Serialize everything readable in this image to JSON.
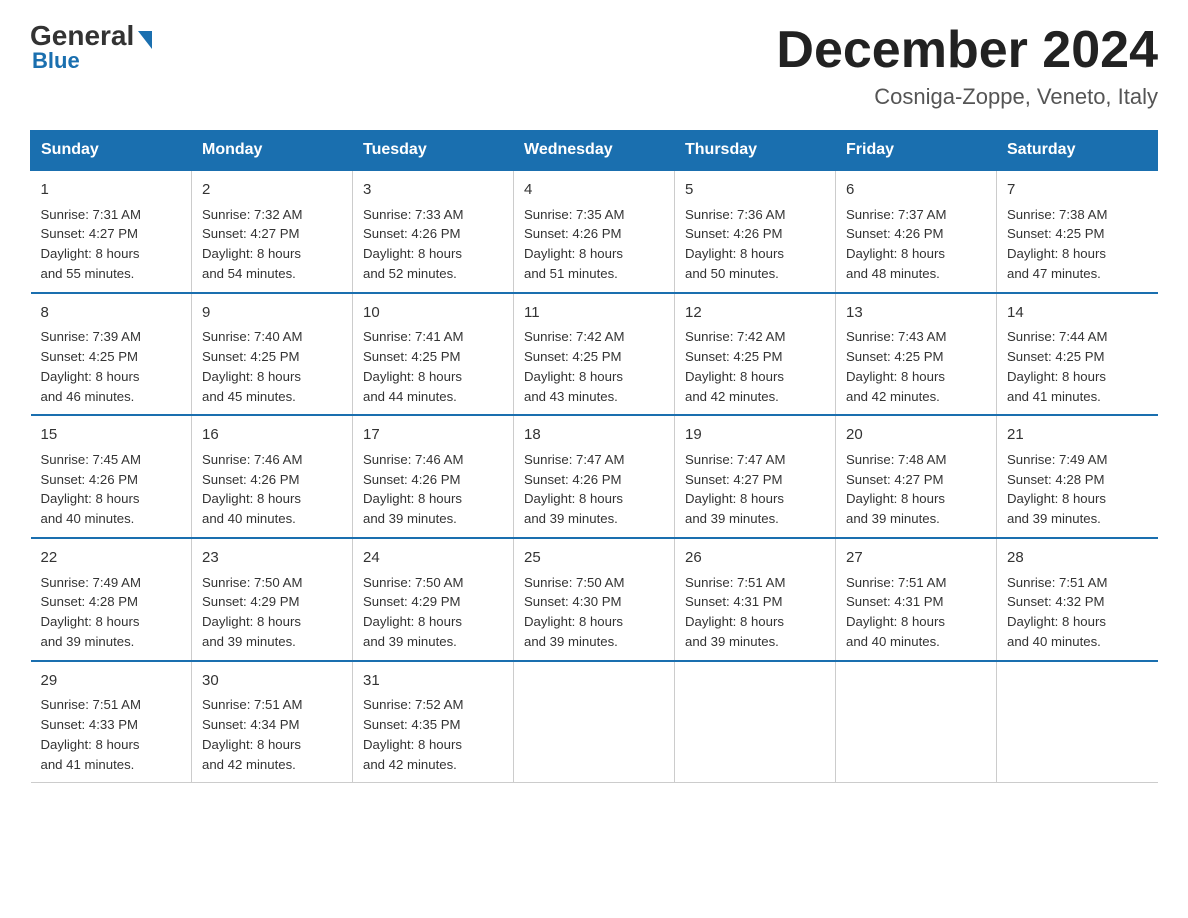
{
  "header": {
    "logo_general": "General",
    "logo_blue": "Blue",
    "title": "December 2024",
    "subtitle": "Cosniga-Zoppe, Veneto, Italy"
  },
  "days_of_week": [
    "Sunday",
    "Monday",
    "Tuesday",
    "Wednesday",
    "Thursday",
    "Friday",
    "Saturday"
  ],
  "weeks": [
    [
      {
        "day": "1",
        "sunrise": "7:31 AM",
        "sunset": "4:27 PM",
        "daylight": "8 hours and 55 minutes."
      },
      {
        "day": "2",
        "sunrise": "7:32 AM",
        "sunset": "4:27 PM",
        "daylight": "8 hours and 54 minutes."
      },
      {
        "day": "3",
        "sunrise": "7:33 AM",
        "sunset": "4:26 PM",
        "daylight": "8 hours and 52 minutes."
      },
      {
        "day": "4",
        "sunrise": "7:35 AM",
        "sunset": "4:26 PM",
        "daylight": "8 hours and 51 minutes."
      },
      {
        "day": "5",
        "sunrise": "7:36 AM",
        "sunset": "4:26 PM",
        "daylight": "8 hours and 50 minutes."
      },
      {
        "day": "6",
        "sunrise": "7:37 AM",
        "sunset": "4:26 PM",
        "daylight": "8 hours and 48 minutes."
      },
      {
        "day": "7",
        "sunrise": "7:38 AM",
        "sunset": "4:25 PM",
        "daylight": "8 hours and 47 minutes."
      }
    ],
    [
      {
        "day": "8",
        "sunrise": "7:39 AM",
        "sunset": "4:25 PM",
        "daylight": "8 hours and 46 minutes."
      },
      {
        "day": "9",
        "sunrise": "7:40 AM",
        "sunset": "4:25 PM",
        "daylight": "8 hours and 45 minutes."
      },
      {
        "day": "10",
        "sunrise": "7:41 AM",
        "sunset": "4:25 PM",
        "daylight": "8 hours and 44 minutes."
      },
      {
        "day": "11",
        "sunrise": "7:42 AM",
        "sunset": "4:25 PM",
        "daylight": "8 hours and 43 minutes."
      },
      {
        "day": "12",
        "sunrise": "7:42 AM",
        "sunset": "4:25 PM",
        "daylight": "8 hours and 42 minutes."
      },
      {
        "day": "13",
        "sunrise": "7:43 AM",
        "sunset": "4:25 PM",
        "daylight": "8 hours and 42 minutes."
      },
      {
        "day": "14",
        "sunrise": "7:44 AM",
        "sunset": "4:25 PM",
        "daylight": "8 hours and 41 minutes."
      }
    ],
    [
      {
        "day": "15",
        "sunrise": "7:45 AM",
        "sunset": "4:26 PM",
        "daylight": "8 hours and 40 minutes."
      },
      {
        "day": "16",
        "sunrise": "7:46 AM",
        "sunset": "4:26 PM",
        "daylight": "8 hours and 40 minutes."
      },
      {
        "day": "17",
        "sunrise": "7:46 AM",
        "sunset": "4:26 PM",
        "daylight": "8 hours and 39 minutes."
      },
      {
        "day": "18",
        "sunrise": "7:47 AM",
        "sunset": "4:26 PM",
        "daylight": "8 hours and 39 minutes."
      },
      {
        "day": "19",
        "sunrise": "7:47 AM",
        "sunset": "4:27 PM",
        "daylight": "8 hours and 39 minutes."
      },
      {
        "day": "20",
        "sunrise": "7:48 AM",
        "sunset": "4:27 PM",
        "daylight": "8 hours and 39 minutes."
      },
      {
        "day": "21",
        "sunrise": "7:49 AM",
        "sunset": "4:28 PM",
        "daylight": "8 hours and 39 minutes."
      }
    ],
    [
      {
        "day": "22",
        "sunrise": "7:49 AM",
        "sunset": "4:28 PM",
        "daylight": "8 hours and 39 minutes."
      },
      {
        "day": "23",
        "sunrise": "7:50 AM",
        "sunset": "4:29 PM",
        "daylight": "8 hours and 39 minutes."
      },
      {
        "day": "24",
        "sunrise": "7:50 AM",
        "sunset": "4:29 PM",
        "daylight": "8 hours and 39 minutes."
      },
      {
        "day": "25",
        "sunrise": "7:50 AM",
        "sunset": "4:30 PM",
        "daylight": "8 hours and 39 minutes."
      },
      {
        "day": "26",
        "sunrise": "7:51 AM",
        "sunset": "4:31 PM",
        "daylight": "8 hours and 39 minutes."
      },
      {
        "day": "27",
        "sunrise": "7:51 AM",
        "sunset": "4:31 PM",
        "daylight": "8 hours and 40 minutes."
      },
      {
        "day": "28",
        "sunrise": "7:51 AM",
        "sunset": "4:32 PM",
        "daylight": "8 hours and 40 minutes."
      }
    ],
    [
      {
        "day": "29",
        "sunrise": "7:51 AM",
        "sunset": "4:33 PM",
        "daylight": "8 hours and 41 minutes."
      },
      {
        "day": "30",
        "sunrise": "7:51 AM",
        "sunset": "4:34 PM",
        "daylight": "8 hours and 42 minutes."
      },
      {
        "day": "31",
        "sunrise": "7:52 AM",
        "sunset": "4:35 PM",
        "daylight": "8 hours and 42 minutes."
      },
      null,
      null,
      null,
      null
    ]
  ],
  "labels": {
    "sunrise": "Sunrise:",
    "sunset": "Sunset:",
    "daylight": "Daylight:"
  }
}
